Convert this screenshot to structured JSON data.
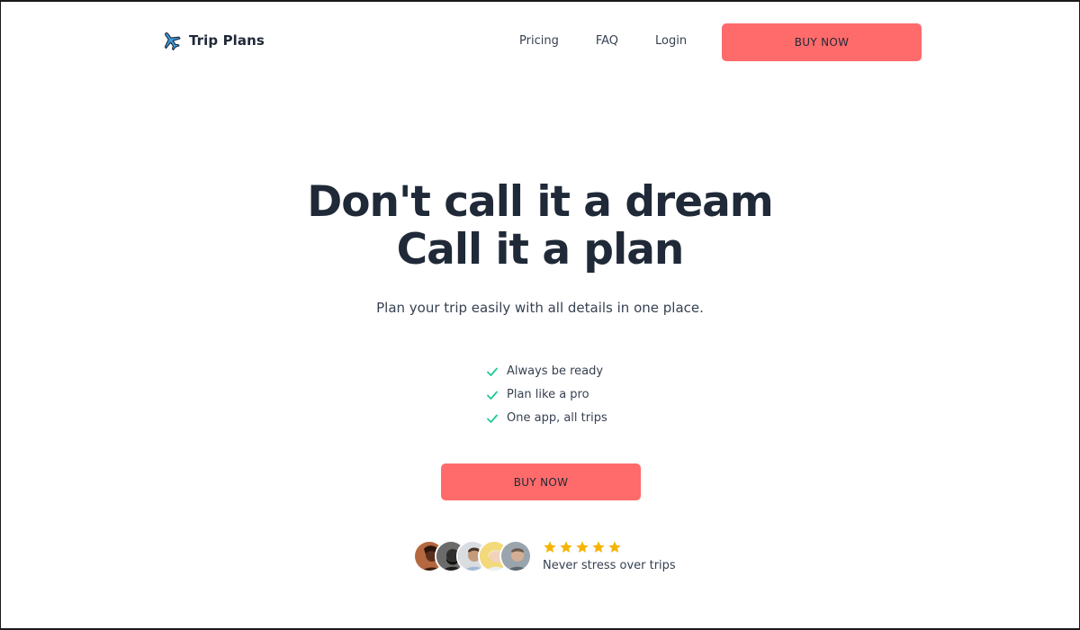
{
  "header": {
    "brand": {
      "name": "Trip Plans",
      "icon": "airplane-icon",
      "icon_color": "#3b9be0"
    },
    "nav": [
      {
        "label": "Pricing"
      },
      {
        "label": "FAQ"
      },
      {
        "label": "Login"
      }
    ],
    "cta_label": "BUY NOW"
  },
  "hero": {
    "title_line1": "Don't call it a dream",
    "title_line2": "Call it a plan",
    "subtitle": "Plan your trip easily with all details in one place.",
    "features": [
      {
        "label": "Always be ready",
        "icon": "check-icon"
      },
      {
        "label": "Plan like a pro",
        "icon": "check-icon"
      },
      {
        "label": "One app, all trips",
        "icon": "check-icon"
      }
    ],
    "cta_label": "BUY NOW"
  },
  "social_proof": {
    "avatar_count": 5,
    "rating_stars": 5,
    "text": "Never stress over trips"
  },
  "colors": {
    "accent": "#ff6b6b",
    "check": "#20c997",
    "star": "#f5b400",
    "heading": "#1f2937"
  }
}
